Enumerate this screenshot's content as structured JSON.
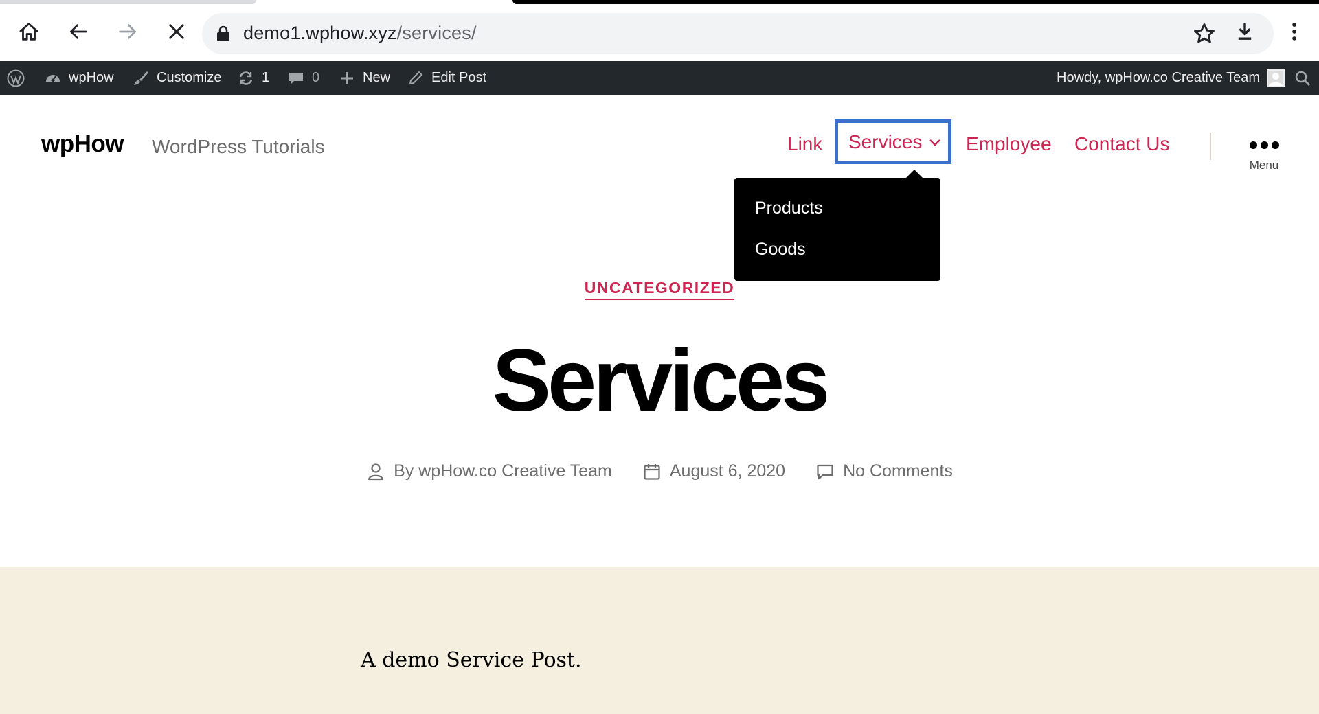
{
  "browser": {
    "url_host": "demo1.wphow.xyz",
    "url_path": "/services/",
    "page_load_progress": 0.7
  },
  "adminbar": {
    "site_name": "wpHow",
    "customize": "Customize",
    "updates_count": "1",
    "comments_count": "0",
    "new_label": "New",
    "edit_post": "Edit Post",
    "howdy": "Howdy, wpHow.co Creative Team"
  },
  "site": {
    "title": "wpHow",
    "description": "WordPress Tutorials"
  },
  "nav": {
    "items": [
      "Link",
      "Services",
      "Employee",
      "Contact Us"
    ],
    "menu_label": "Menu",
    "submenu": [
      "Products",
      "Goods"
    ]
  },
  "post": {
    "category": "UNCATEGORIZED",
    "title": "Services",
    "author": "By wpHow.co Creative Team",
    "date": "August 6, 2020",
    "comments": "No Comments",
    "body": "A demo Service Post."
  },
  "colors": {
    "accent": "#cd2653",
    "highlight_box": "#3b6fcc",
    "admin_bar": "#23282d",
    "content_bg": "#f5efe0"
  }
}
